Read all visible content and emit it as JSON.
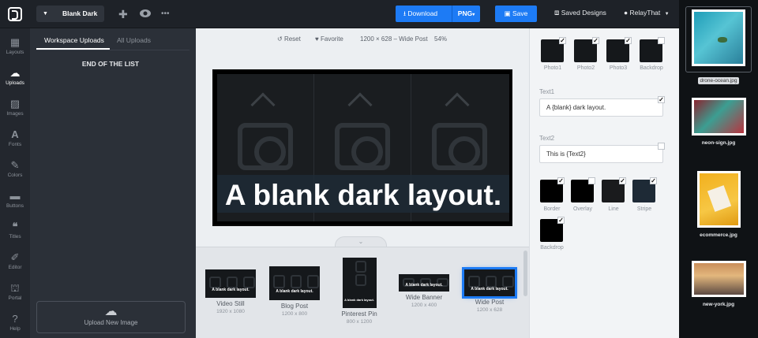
{
  "topbar": {
    "logo": "relaythat-logo",
    "design_name": "Blank Dark",
    "download_label": "Download",
    "format_label": "PNG",
    "save_label": "Save",
    "saved_designs_label": "Saved Designs",
    "user_label": "RelayThat",
    "accent_color": "#1d7bf5"
  },
  "rail": {
    "items": [
      {
        "label": "Layouts",
        "icon": "layouts-icon"
      },
      {
        "label": "Uploads",
        "icon": "upload-icon"
      },
      {
        "label": "Images",
        "icon": "images-icon"
      },
      {
        "label": "Fonts",
        "icon": "fonts-icon"
      },
      {
        "label": "Colors",
        "icon": "colors-icon"
      },
      {
        "label": "Buttons",
        "icon": "buttons-icon"
      },
      {
        "label": "Titles",
        "icon": "titles-icon"
      },
      {
        "label": "Editor",
        "icon": "editor-icon"
      },
      {
        "label": "Portal",
        "icon": "portal-icon"
      },
      {
        "label": "Help",
        "icon": "help-icon"
      }
    ],
    "active": "Uploads"
  },
  "uploads": {
    "tabs": [
      "Workspace Uploads",
      "All Uploads"
    ],
    "end_of_list": "END OF THE LIST",
    "upload_new": "Upload New Image"
  },
  "canvas": {
    "reset_label": "Reset",
    "favorite_label": "Favorite",
    "size_label": "1200 × 628 – Wide Post",
    "zoom_label": "54%",
    "headline": "A blank dark layout."
  },
  "templates": [
    {
      "name": "Video Still",
      "size": "1920 x 1080",
      "thumb_text": "A blank dark layout."
    },
    {
      "name": "Blog Post",
      "size": "1200 x 800",
      "thumb_text": "A blank dark layout."
    },
    {
      "name": "Pinterest Pin",
      "size": "800 x 1200",
      "thumb_text": "A blank dark layout."
    },
    {
      "name": "Wide Banner",
      "size": "1200 x 400",
      "thumb_text": "A blank dark layout."
    },
    {
      "name": "Wide Post",
      "size": "1200 x 628",
      "thumb_text": "A blank dark layout.",
      "selected": true
    }
  ],
  "props": {
    "photos": [
      {
        "label": "Photo1",
        "checked": true
      },
      {
        "label": "Photo2",
        "checked": true
      },
      {
        "label": "Photo3",
        "checked": true
      },
      {
        "label": "Backdrop",
        "checked": false
      }
    ],
    "text1": {
      "label": "Text1",
      "value": "A {blank} dark layout.",
      "checked": true
    },
    "text2": {
      "label": "Text2",
      "value": "This is {Text2}",
      "checked": false
    },
    "colors": [
      {
        "label": "Border",
        "color": "#000000",
        "checked": true
      },
      {
        "label": "Overlay",
        "color": "#000000",
        "checked": false
      },
      {
        "label": "Line",
        "color": "#1a1b1d",
        "checked": true
      },
      {
        "label": "Stripe",
        "color": "#1e2a36",
        "checked": true
      },
      {
        "label": "Backdrop",
        "color": "#000000",
        "checked": true
      }
    ]
  },
  "strip": {
    "images": [
      {
        "name": "drone-ocean.jpg",
        "selected": true
      },
      {
        "name": "neon-sign.jpg",
        "selected": false
      },
      {
        "name": "ecommerce.jpg",
        "selected": false
      },
      {
        "name": "new-york.jpg",
        "selected": false
      }
    ]
  }
}
